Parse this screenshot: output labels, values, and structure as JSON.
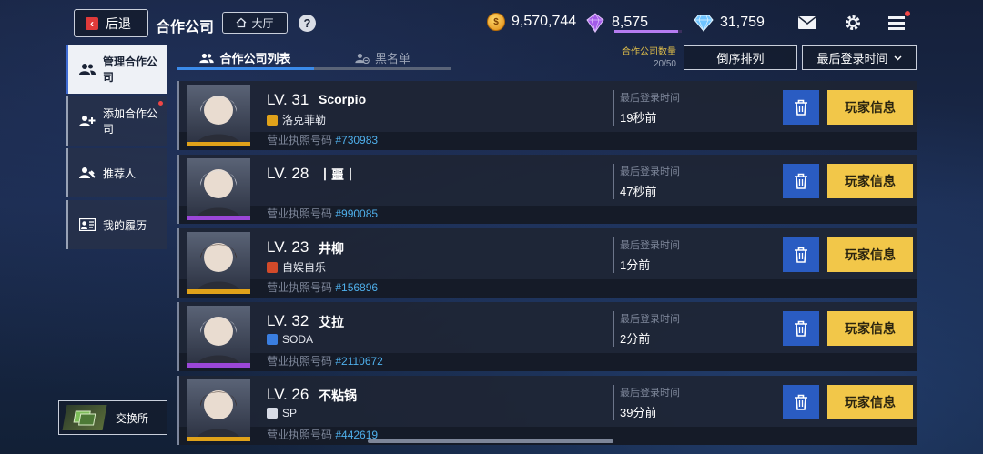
{
  "header": {
    "back_label": "后退",
    "title": "合作公司",
    "hall_label": "大厅",
    "help_label": "?"
  },
  "resources": {
    "coins": "9,570,744",
    "crystals": "8,575",
    "crystal_progress": 0.95,
    "diamonds": "31,759"
  },
  "icons": {
    "mail": "mail-icon",
    "settings": "gear-icon",
    "menu": "menu-icon"
  },
  "sidebar": {
    "items": [
      {
        "label": "管理合作公司",
        "active": true
      },
      {
        "label": "添加合作公司",
        "active": false,
        "dot": true
      },
      {
        "label": "推荐人",
        "active": false
      },
      {
        "label": "我的履历",
        "active": false
      }
    ],
    "exchange_label": "交换所"
  },
  "tabs": [
    {
      "label": "合作公司列表",
      "active": true
    },
    {
      "label": "黑名单",
      "active": false
    }
  ],
  "count": {
    "label": "合作公司数量",
    "value": "20/50"
  },
  "sort": {
    "label": "倒序排列"
  },
  "filter": {
    "label": "最后登录时间"
  },
  "list": {
    "login_label": "最后登录时间",
    "license_label": "营业执照号码",
    "delete_icon": "trash-icon",
    "info_label": "玩家信息",
    "rows": [
      {
        "level": "LV. 31",
        "name": "Scorpio",
        "guild": "洛克菲勒",
        "license": "#730983",
        "login": "19秒前",
        "guild_color": "#e0a21a",
        "strip": "#e0a21a"
      },
      {
        "level": "LV. 28",
        "name": "丨噩丨",
        "guild": "",
        "license": "#990085",
        "login": "47秒前",
        "guild_color": "",
        "strip": "#9b47d8"
      },
      {
        "level": "LV. 23",
        "name": "井柳",
        "guild": "自娱自乐",
        "license": "#156896",
        "login": "1分前",
        "guild_color": "#d24a2a",
        "strip": "#e0a21a"
      },
      {
        "level": "LV. 32",
        "name": "艾拉",
        "guild": "SODA",
        "license": "#2110672",
        "login": "2分前",
        "guild_color": "#3a7ee0",
        "strip": "#9b47d8"
      },
      {
        "level": "LV. 26",
        "name": "不粘锅",
        "guild": "SP",
        "license": "#442619",
        "login": "39分前",
        "guild_color": "#d8dce6",
        "strip": "#e0a21a"
      }
    ]
  },
  "colors": {
    "accent_blue": "#3b8bea",
    "info_yellow": "#f2c749",
    "delete_blue": "#2a5cc2",
    "license_blue": "#4fb0ec"
  }
}
